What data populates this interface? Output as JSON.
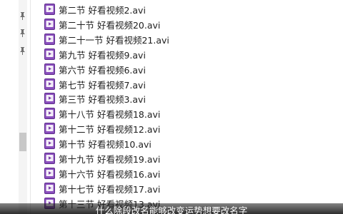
{
  "explorer": {
    "files": [
      {
        "name": "第二节 好看视频2.avi"
      },
      {
        "name": "第二十节 好看视频20.avi"
      },
      {
        "name": "第二十一节 好看视频21.avi"
      },
      {
        "name": "第九节 好看视频9.avi"
      },
      {
        "name": "第六节 好看视频6.avi"
      },
      {
        "name": "第七节 好看视频7.avi"
      },
      {
        "name": "第三节 好看视频3.avi"
      },
      {
        "name": "第十八节 好看视频18.avi"
      },
      {
        "name": "第十二节 好看视频12.avi"
      },
      {
        "name": "第十节 好看视频10.avi"
      },
      {
        "name": "第十九节 好看视频19.avi"
      },
      {
        "name": "第十六节 好看视频16.avi"
      },
      {
        "name": "第十七节 好看视频17.avi"
      },
      {
        "name": "第十三节 好看视频13.avi"
      }
    ],
    "file_icon": "video-file-icon",
    "nav_icon": "pin-icon",
    "icon_color": "#7a3fa8"
  },
  "caption": {
    "text": "什么除段改名能够改变运势想要改名字"
  }
}
